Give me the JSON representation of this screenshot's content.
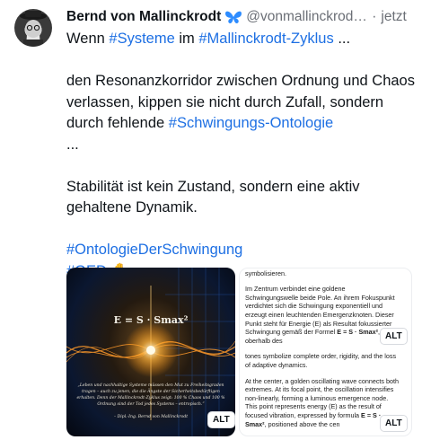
{
  "author": {
    "display_name": "Bernd von Mallinckrodt",
    "badge_icon": "butterfly-icon",
    "handle": "@vonmallinckrodt.bsky.social",
    "separator": "·",
    "time": "jetzt"
  },
  "post": {
    "line1_prefix": "Wenn ",
    "tag_systeme": "#Systeme",
    "line1_mid": " im ",
    "tag_zyklus": "#Mallinckrodt-Zyklus",
    "line1_suffix": " ...",
    "para2_text": "den Resonanzkorridor zwischen Ordnung und Chaos verlassen, kippen sie nicht durch Zufall, sondern durch fehlende ",
    "tag_ontologie": "#Schwingungs-Ontologie",
    "para2_suffix": " ...",
    "para3_text": "Stabilität ist kein Zustand, sondern eine aktiv gehaltene Dynamik.",
    "tag_ontologie_der_schwingung": "#OntologieDerSchwingung",
    "tag_qed": "#QED",
    "hand_emoji": "✋"
  },
  "media": {
    "image1": {
      "formula": "E = S · Smax²",
      "quote": "„Leben und nachhaltige Systeme müssen den Mut zu Freiheitsgraden tragen – auch zu jenen, die die Ängste der Sicherheitsbedürftigen erhalten. Denn der Mallinckrodt-Zyklus zeigt: 100 % Chaos und 100 % Ordnung sind der Tod jedes Systems – entropisch.“",
      "attribution": "– Dipl.-Ing. Bernd von Mallinckrodt",
      "alt_label": "ALT"
    },
    "image2": {
      "p1": "Ordnung, Erstarrung und Verlust adaptiver Dynamik symbolisieren.",
      "p2_a": "Im Zentrum verbindet eine goldene Schwingungswelle beide Pole. An ihrem Fokuspunkt verdichtet sich die Schwingung exponentiell und erzeugt einen leuchtenden Emergenzknoten. Dieser Punkt steht für Energie (E) als Resultat fokussierter Schwingung gemäß der Formel ",
      "p2_formula": "E = S · Smax²",
      "p2_b": ", die oberhalb des",
      "p3": "tones symbolize complete order, rigidity, and the loss of adaptive dynamics.",
      "p4_a": "At the center, a golden oscillating wave connects both extremes. At its focal point, the oscillation intensifies non-linearly, forming a luminous emergence node. This point represents energy (E) as the result of focused vibration, expressed by formula ",
      "p4_formula": "E = S · Smax²",
      "p4_b": ", positioned above the cen",
      "alt_label_top": "ALT",
      "alt_label_bottom": "ALT"
    }
  },
  "colors": {
    "link": "#1d6fe3",
    "text": "#0f1419",
    "muted": "#6b6f76",
    "badge": "#2d8cff"
  }
}
